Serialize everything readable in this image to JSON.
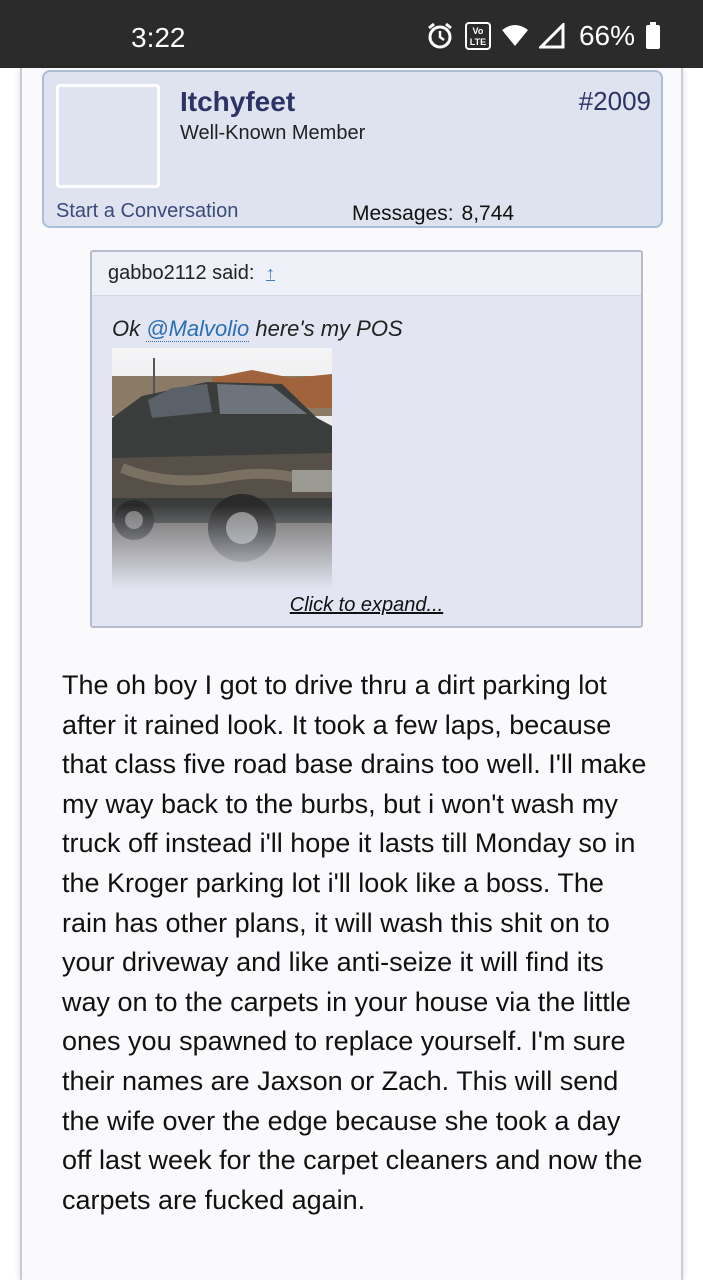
{
  "status_bar": {
    "time": "3:22",
    "volte_label": "Vo LTE",
    "battery": "66%"
  },
  "post": {
    "member": {
      "username": "Itchyfeet",
      "title": "Well-Known Member",
      "post_number": "#2009",
      "start_conversation": "Start a Conversation",
      "messages_label": "Messages:",
      "messages_count": "8,744"
    },
    "quote": {
      "author": "gabbo2112 said:",
      "jump_icon": "up-arrow-icon",
      "text_before": "Ok ",
      "mention": "@Malvolio",
      "text_after": " here's my POS",
      "image_alt": "muddy pickup truck photo",
      "expand": "Click to expand..."
    },
    "body": "The oh boy I got to drive thru a dirt parking lot after it rained look. It took a few laps, because that class five road base drains too well. I'll make my way back to the burbs, but i won't wash my truck off instead i'll hope it lasts till Monday so in the Kroger parking lot i'll look like a boss. The rain has other plans, it will wash this shit on to your driveway and like anti-seize it will find its way on to the carpets in your house via the little ones you spawned to replace yourself. I'm sure their names are Jaxson or Zach. This will send the wife over the edge because she took a day off last week for the carpet cleaners and now the carpets are fucked again."
  },
  "colors": {
    "status_bar_bg": "#2b2b2b",
    "member_card_bg": "#dfe3ef",
    "member_card_border": "#a9bfd6",
    "username": "#2c3466",
    "mention_link": "#2b6fb5",
    "quote_bg": "#e3e6f2"
  }
}
